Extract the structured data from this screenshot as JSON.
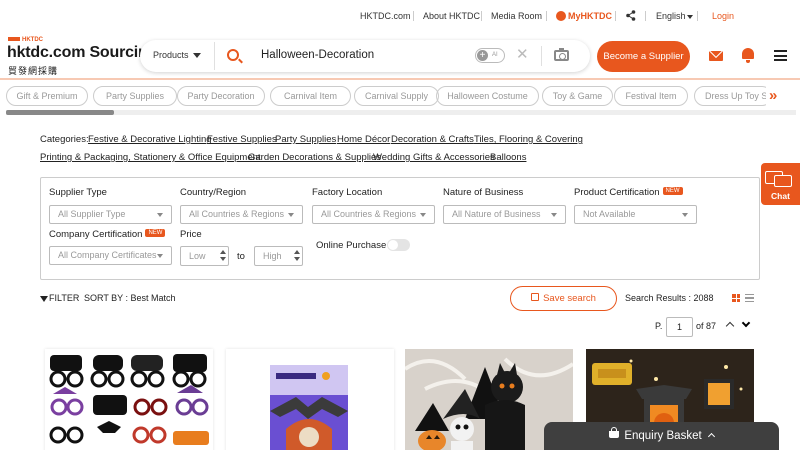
{
  "topbar": {
    "site_link": "HKTDC.com",
    "about": "About HKTDC",
    "media": "Media Room",
    "myhktdc": "MyHKTDC",
    "language": "English",
    "login": "Login"
  },
  "header": {
    "logo_small": "HKTDC",
    "logo_main": "hktdc.com Sourcing",
    "logo_cn": "貿發網採購",
    "products_label": "Products",
    "search_value": "Halloween-Decoration",
    "ai_label": "AI",
    "become_supplier": "Become a Supplier"
  },
  "related_tags": [
    "Gift & Premium",
    "Party Supplies",
    "Party Decoration",
    "Carnival Item",
    "Carnival Supply",
    "Halloween Costume",
    "Toy & Game",
    "Festival Item",
    "Dress Up Toy Set"
  ],
  "categories": {
    "label": "Categories:",
    "links": [
      "Festive & Decorative Lighting",
      "Festive Supplies",
      "Party Supplies",
      "Home Décor",
      "Decoration & Crafts",
      "Tiles, Flooring & Covering",
      "Printing & Packaging, Stationery & Office Equipment",
      "Garden Decorations & Supplies",
      "Wedding Gifts & Accessories",
      "Balloons"
    ]
  },
  "filters": {
    "supplier_type": {
      "label": "Supplier Type",
      "value": "All Supplier Type"
    },
    "country": {
      "label": "Country/Region",
      "value": "All Countries & Regions"
    },
    "factory": {
      "label": "Factory Location",
      "value": "All Countries & Regions"
    },
    "nature": {
      "label": "Nature of Business",
      "value": "All Nature of Business"
    },
    "product_cert": {
      "label": "Product Certification",
      "badge": "NEW",
      "value": "Not Available"
    },
    "company_cert": {
      "label": "Company Certification",
      "badge": "NEW",
      "value": "All Company Certificates"
    },
    "price": {
      "label": "Price",
      "low": "Low",
      "to": "to",
      "high": "High"
    },
    "online_purchase": {
      "label": "Online Purchase",
      "on": false
    }
  },
  "results": {
    "filter_label": "FILTER",
    "sort_label": "SORT BY : Best Match",
    "save_search": "Save search",
    "count_text": "Search Results : 2088",
    "page_prefix": "P.",
    "page_current": "1",
    "page_total_text": "of 87"
  },
  "chat_label": "Chat",
  "basket_label": "Enquiry Basket",
  "colors": {
    "accent": "#e8571e",
    "basket_bg": "#3f3f3f"
  }
}
